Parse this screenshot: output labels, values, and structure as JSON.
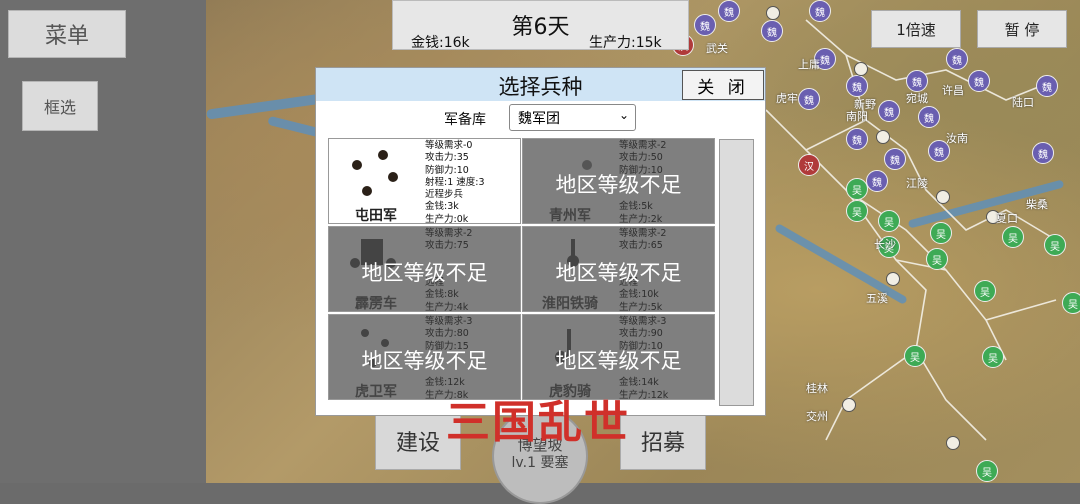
{
  "sidebar": {
    "menu_label": "菜单",
    "box_select_label": "框选"
  },
  "topbar": {
    "day_label": "第6天",
    "money": "金钱:16k",
    "production": "生产力:15k",
    "speed_label": "1倍速",
    "pause_label": "暂 停"
  },
  "map": {
    "wei_label": "魏",
    "wu_label": "吴",
    "han_label": "汉",
    "place_names": [
      "武关",
      "上庸",
      "新野",
      "宛城",
      "南阳",
      "江陵",
      "长沙",
      "桂林",
      "交州",
      "五溪",
      "夏口",
      "柴桑",
      "汝南",
      "许昌",
      "陆口",
      "虎牢"
    ]
  },
  "dialog": {
    "title": "选择兵种",
    "close_label": "关 闭",
    "armory_label": "军备库",
    "armory_value": "魏军团",
    "locked_text": "地区等级不足",
    "units": [
      {
        "name": "屯田军",
        "stats": "等级需求-0\n攻击力:35\n防御力:10\n射程:1 速度:3\n近程步兵\n金钱:3k\n生产力:0k",
        "locked": false
      },
      {
        "name": "青州军",
        "stats": "等级需求-2\n攻击力:50\n防御力:10\n\n\n金钱:5k\n生产力:2k",
        "locked": true
      },
      {
        "name": "霹雳车",
        "stats": "等级需求-2\n攻击力:75\n\n\n远程\n金钱:8k\n生产力:4k",
        "locked": true
      },
      {
        "name": "淮阳铁骑",
        "stats": "等级需求-2\n攻击力:65\n\n\n近程\n金钱:10k\n生产力:5k",
        "locked": true
      },
      {
        "name": "虎卫军",
        "stats": "等级需求-3\n攻击力:80\n防御力:15\n\n\n金钱:12k\n生产力:8k",
        "locked": true
      },
      {
        "name": "虎豹骑",
        "stats": "等级需求-3\n攻击力:90\n防御力:10\n\n\n金钱:14k\n生产力:12k",
        "locked": true
      }
    ]
  },
  "bottom": {
    "build_label": "建设",
    "recruit_label": "招募",
    "city_name": "博望坡",
    "city_level": "lv.1 要塞",
    "watermark": "三国乱世"
  },
  "colors": {
    "wei": "#6a5fb0",
    "wu": "#3eaa55",
    "han": "#b03a3a",
    "watermark": "#d0302a",
    "dialog_title_bg": "#cfe4f5"
  }
}
